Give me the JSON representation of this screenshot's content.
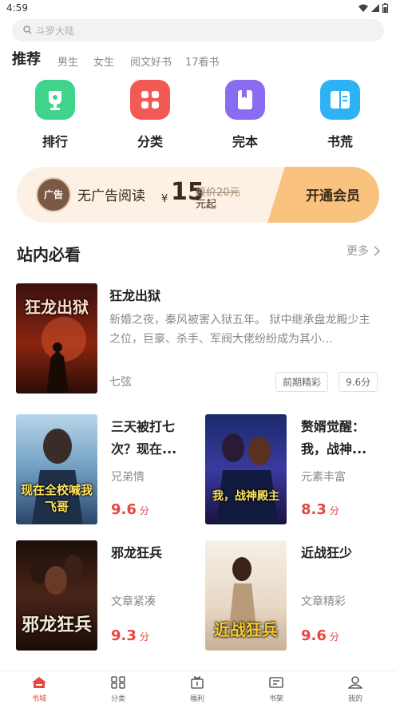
{
  "status": {
    "time": "4:59"
  },
  "search": {
    "placeholder": "斗罗大陆"
  },
  "tabs": [
    {
      "label": "推荐",
      "active": true
    },
    {
      "label": "男生"
    },
    {
      "label": "女生"
    },
    {
      "label": "阅文好书"
    },
    {
      "label": "17看书"
    }
  ],
  "categories": [
    {
      "label": "排行",
      "icon": "trophy-icon",
      "color": "#3fd38b"
    },
    {
      "label": "分类",
      "icon": "grid-icon",
      "color": "#f25b55"
    },
    {
      "label": "完本",
      "icon": "book-closed-icon",
      "color": "#8a6cf2"
    },
    {
      "label": "书荒",
      "icon": "book-open-icon",
      "color": "#2fb2f5"
    }
  ],
  "vip": {
    "badge": "广告",
    "text": "无广告阅读",
    "yen": "¥",
    "price": "15",
    "original": "原价20元",
    "unit": "元起",
    "button": "开通会员"
  },
  "section": {
    "title": "站内必看",
    "more": "更多"
  },
  "featured": {
    "title": "狂龙出狱",
    "desc": "新婚之夜，秦风被害入狱五年。 狱中继承盘龙殿少主之位，巨豪、杀手、军阀大佬纷纷成为其小...",
    "author": "七弦",
    "tag": "前期精彩",
    "score": "9.6分",
    "cover_text": "狂龙出狱"
  },
  "books": [
    {
      "title_line1": "三天被打七",
      "title_line2": "次？现在...",
      "author": "兄弟情",
      "score": "9.6",
      "score_unit": "分",
      "cover_text": "现在全校喊我飞哥"
    },
    {
      "title_line1": "赘婿觉醒：",
      "title_line2": "我，战神...",
      "author": "元素丰富",
      "score": "8.3",
      "score_unit": "分",
      "cover_text": "我，战神殿主"
    },
    {
      "title_line1": "邪龙狂兵",
      "title_line2": "",
      "author": "文章紧凑",
      "score": "9.3",
      "score_unit": "分",
      "cover_text": "邪龙狂兵"
    },
    {
      "title_line1": "近战狂少",
      "title_line2": "",
      "author": "文章精彩",
      "score": "9.6",
      "score_unit": "分",
      "cover_text": "近战狂兵"
    }
  ],
  "nav": [
    {
      "label": "书城",
      "active": true
    },
    {
      "label": "分类"
    },
    {
      "label": "福利"
    },
    {
      "label": "书架"
    },
    {
      "label": "我的"
    }
  ],
  "colors": {
    "accent": "#e8463e",
    "vip_bg": "#fdf0e4",
    "vip_btn": "#f9c27e"
  }
}
